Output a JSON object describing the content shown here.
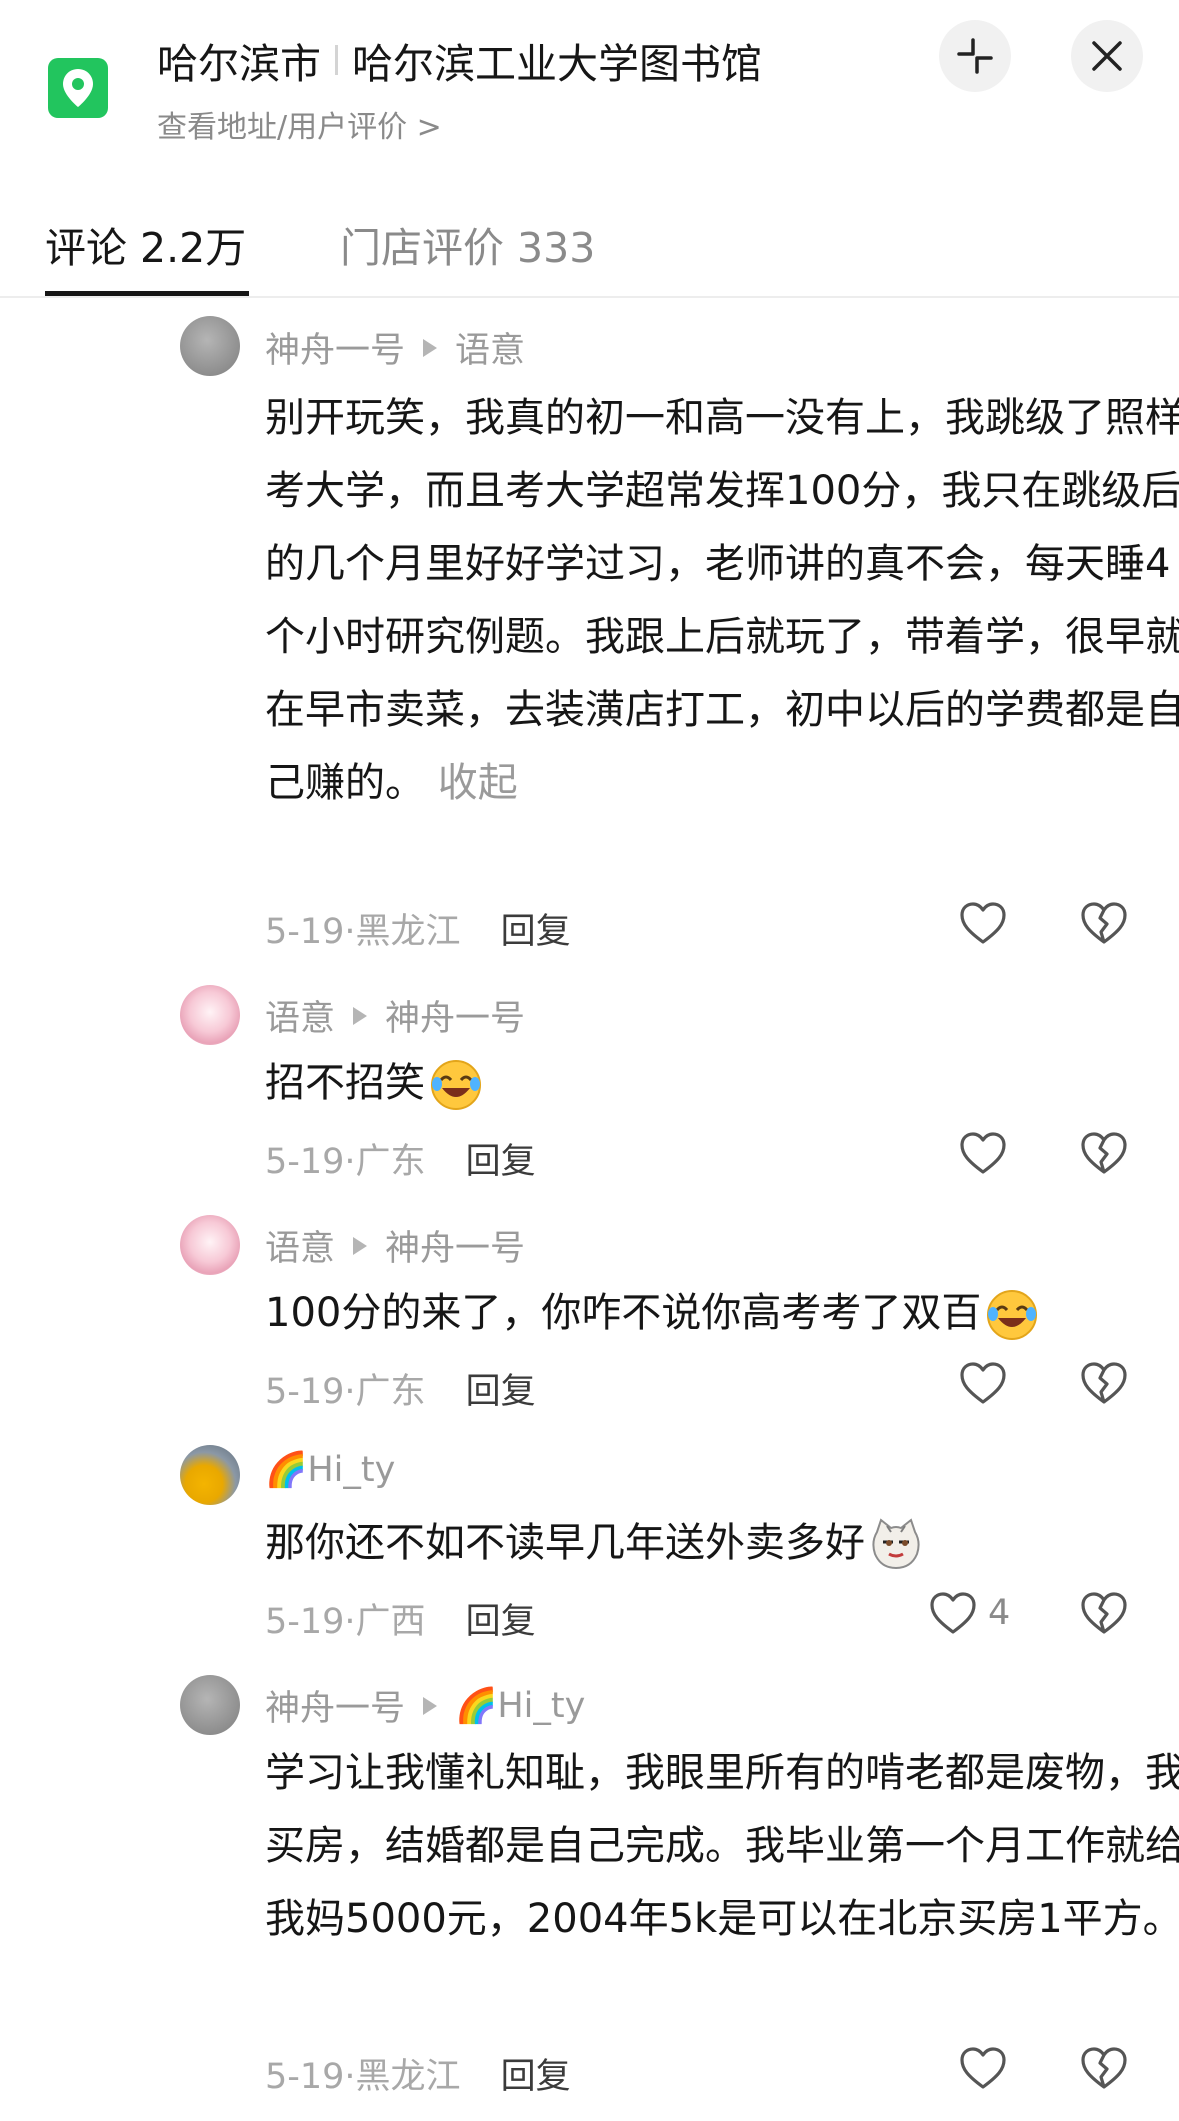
{
  "header": {
    "location_icon": "map-pin-icon",
    "city": "哈尔滨市",
    "place": "哈尔滨工业大学图书馆",
    "subtitle": "查看地址/用户评价 >",
    "shrink_icon": "collapse-icon",
    "close_icon": "close-icon"
  },
  "tabs": [
    {
      "label": "评论 2.2万",
      "active": true
    },
    {
      "label": "门店评价 333",
      "active": false
    }
  ],
  "comments": [
    {
      "user": "神舟一号",
      "reply_to": "语意",
      "text": "别开玩笑，我真的初一和高一没有上，我跳级了照样考大学，而且考大学超常发挥100分，我只在跳级后的几个月里好好学过习，老师讲的真不会，每天睡4个小时研究例题。我跟上后就玩了，带着学，很早就在早市卖菜，去装潢店打工，初中以后的学费都是自己赚的。",
      "collapse": "收起",
      "date": "5-19·黑龙江",
      "reply_label": "回复",
      "likes": ""
    },
    {
      "user": "语意",
      "reply_to": "神舟一号",
      "text": "招不招笑",
      "date": "5-19·广东",
      "reply_label": "回复",
      "likes": ""
    },
    {
      "user": "语意",
      "reply_to": "神舟一号",
      "text": "100分的来了，你咋不说你高考考了双百",
      "date": "5-19·广东",
      "reply_label": "回复",
      "likes": ""
    },
    {
      "user": "Hi_ty",
      "user_prefix_icon": "rainbow-icon",
      "text": "那你还不如不读早几年送外卖多好",
      "date": "5-19·广西",
      "reply_label": "回复",
      "likes": "4"
    },
    {
      "user": "神舟一号",
      "reply_to": "Hi_ty",
      "text": "学习让我懂礼知耻，我眼里所有的啃老都是废物，我买房，结婚都是自己完成。我毕业第一个月工作就给我妈5000元，2004年5k是可以在北京买房1平方。",
      "date": "5-19·黑龙江",
      "reply_label": "回复",
      "likes": ""
    }
  ],
  "colors": {
    "accent_green": "#22c55e",
    "text": "#161616",
    "muted": "#9a9a9a"
  }
}
